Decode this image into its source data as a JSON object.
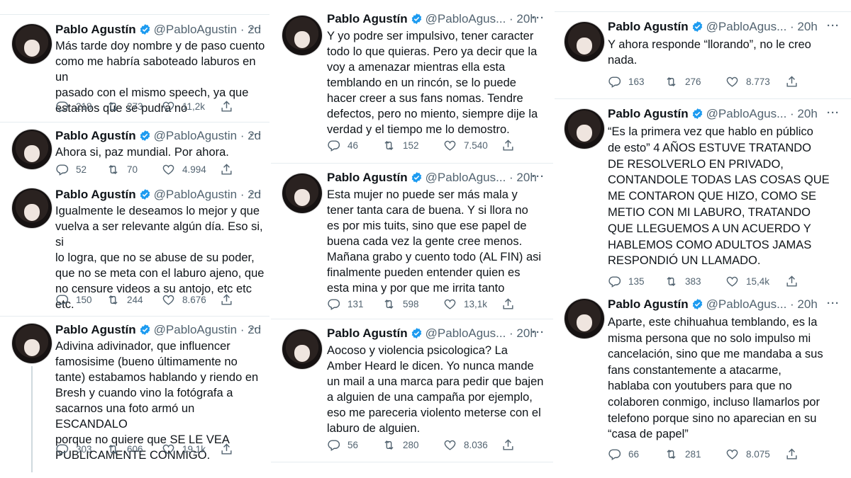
{
  "col1": [
    {
      "name": "Pablo Agustín",
      "handle": "@PabloAgustin",
      "time": "2d",
      "text": "Más tarde doy nombre y de paso cuento\ncomo me habría saboteado laburos en un\npasado con el mismo speech, ya que\nestamos que se pudra no",
      "replies": "218",
      "retweets": "273",
      "likes": "11,2k"
    },
    {
      "name": "Pablo Agustín",
      "handle": "@PabloAgustin",
      "time": "2d",
      "text": "Ahora si, paz mundial. Por ahora.",
      "replies": "52",
      "retweets": "70",
      "likes": "4.994"
    },
    {
      "name": "Pablo Agustín",
      "handle": "@PabloAgustin",
      "time": "2d",
      "text": "Igualmente le deseamos lo mejor y que\nvuelva a ser relevante algún día. Eso si, si\nlo logra, que no se abuse de su poder,\nque no se meta con el laburo ajeno, que\nno censure videos a su antojo, etc etc\netc.",
      "replies": "150",
      "retweets": "244",
      "likes": "8.676"
    },
    {
      "name": "Pablo Agustín",
      "handle": "@PabloAgustin",
      "time": "2d",
      "text": "Adivina adivinador, que influencer\nfamosisime (bueno últimamente no\ntante) estabamos hablando y riendo en\nBresh y cuando vino la fotógrafa a\nsacarnos una foto armó un ESCANDALO\nporque no quiere que SE LE VEA\nPUBLICAMENTE CONMIGO.",
      "replies": "303",
      "retweets": "606",
      "likes": "19,1k"
    }
  ],
  "col2": [
    {
      "name": "Pablo Agustín",
      "handle": "@PabloAgus...",
      "time": "20h",
      "text": "Y yo podre ser impulsivo, tener caracter\ntodo lo que quieras. Pero ya decir que la\nvoy a amenazar mientras ella esta\ntemblando en un rincón, se lo puede\nhacer creer a sus fans nomas. Tendre\ndefectos, pero no miento, siempre dije la\nverdad y el tiempo me lo demostro.",
      "replies": "46",
      "retweets": "152",
      "likes": "7.540"
    },
    {
      "name": "Pablo Agustín",
      "handle": "@PabloAgus...",
      "time": "20h",
      "text": "Esta mujer no puede ser más mala y\ntener tanta cara de buena. Y si llora no\nes por mis tuits, sino que ese papel de\nbuena cada vez la gente cree menos.\nMañana grabo y cuento todo (AL FIN) asi\nfinalmente pueden entender quien es\nesta mina y por que me irrita tanto",
      "replies": "131",
      "retweets": "598",
      "likes": "13,1k"
    },
    {
      "name": "Pablo Agustín",
      "handle": "@PabloAgus...",
      "time": "20h",
      "text": "Aocoso y violencia psicologica? La\nAmber Heard le dicen. Yo nunca mande\nun mail a una marca para pedir que bajen\na alguien de una campaña por ejemplo,\neso me pareceria violento meterse con el\nlaburo de alguien.",
      "replies": "56",
      "retweets": "280",
      "likes": "8.036"
    }
  ],
  "col3": [
    {
      "name": "Pablo Agustín",
      "handle": "@PabloAgus...",
      "time": "20h",
      "text": "Y ahora responde “llorando”, no le creo\nnada.",
      "replies": "163",
      "retweets": "276",
      "likes": "8.773"
    },
    {
      "name": "Pablo Agustín",
      "handle": "@PabloAgus...",
      "time": "20h",
      "text": "“Es la primera vez que hablo en público\nde esto” 4 AÑOS ESTUVE TRATANDO\nDE RESOLVERLO EN PRIVADO,\nCONTANDOLE TODAS LAS COSAS QUE\nME CONTARON QUE HIZO, COMO SE\nMETIO CON MI LABURO, TRATANDO\nQUE LLEGUEMOS A UN ACUERDO Y\nHABLEMOS COMO ADULTOS JAMAS\nRESPONDIÓ UN LLAMADO.",
      "replies": "135",
      "retweets": "383",
      "likes": "15,4k"
    },
    {
      "name": "Pablo Agustín",
      "handle": "@PabloAgus...",
      "time": "20h",
      "text": "Aparte, este chihuahua temblando, es la\nmisma persona que no solo impulso mi\ncancelación, sino que me mandaba a sus\nfans constantemente a atacarme,\nhablaba con youtubers para que no\ncolaboren conmigo, incluso llamarlos por\ntelefono porque sino no aparecian en su\n“casa de papel”",
      "replies": "66",
      "retweets": "281",
      "likes": "8.075"
    }
  ],
  "colors": {
    "text": "#0f1419",
    "muted": "#536471",
    "verified": "#1d9bf0",
    "divider": "#e6ecf0"
  },
  "icons": [
    "reply-icon",
    "retweet-icon",
    "like-icon",
    "share-icon",
    "verified-badge-icon",
    "more-icon"
  ]
}
